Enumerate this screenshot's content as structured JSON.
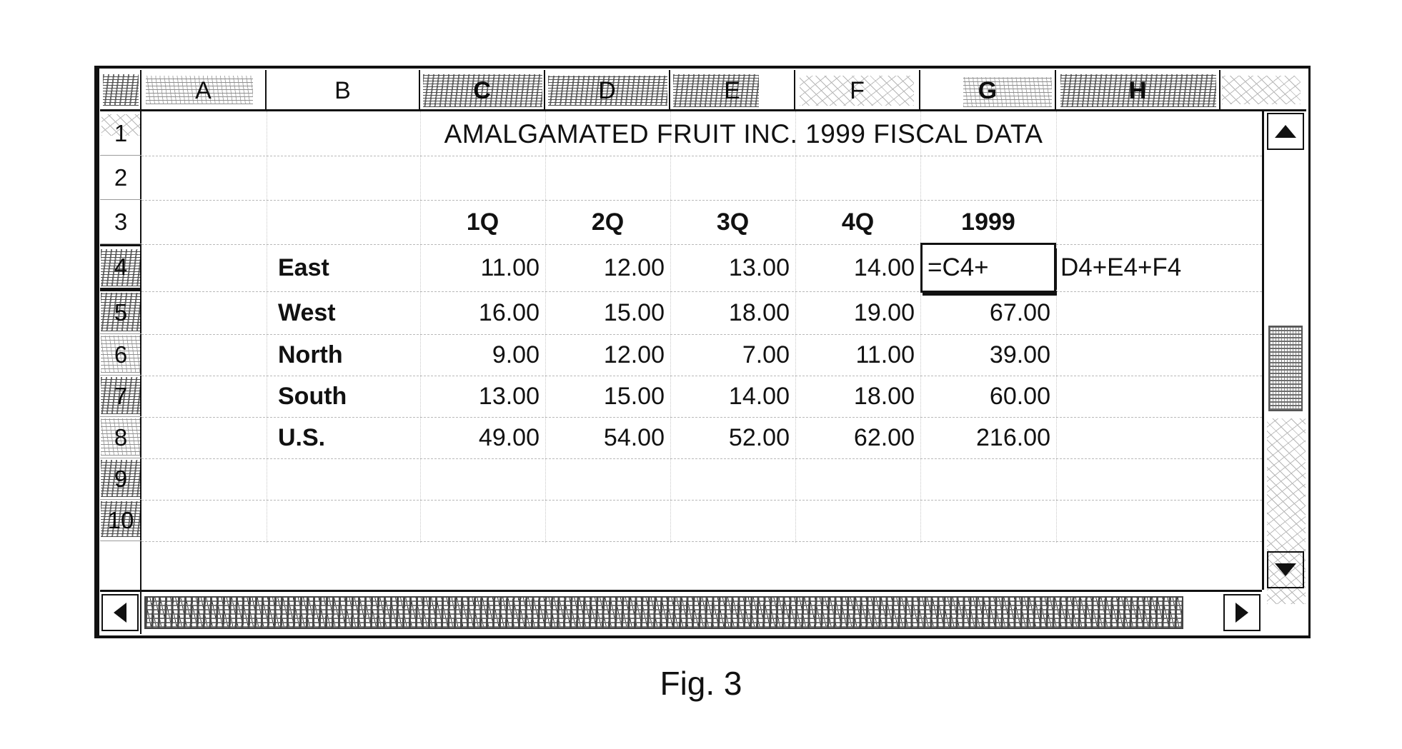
{
  "figure": {
    "caption": "Fig. 3"
  },
  "spreadsheet": {
    "column_headers": [
      "A",
      "B",
      "C",
      "D",
      "E",
      "F",
      "G",
      "H"
    ],
    "row_headers": [
      "1",
      "2",
      "3",
      "4",
      "5",
      "6",
      "7",
      "8",
      "9",
      "10"
    ],
    "selected_row_header": "4",
    "active_cell": {
      "reference": "G4",
      "editing": true,
      "content": "=C4+D4+E4+F4",
      "segment_in_cell": "=C4+",
      "segment_overflow": "D4+E4+F4"
    },
    "title_cell": {
      "row": "1",
      "text": "AMALGAMATED FRUIT INC. 1999 FISCAL DATA"
    },
    "header_row": {
      "row": "3",
      "labels": [
        "1Q",
        "2Q",
        "3Q",
        "4Q",
        "1999"
      ]
    },
    "data_rows": [
      {
        "row": "4",
        "label": "East",
        "q1": "11.00",
        "q2": "12.00",
        "q3": "13.00",
        "q4": "14.00",
        "total": "=C4+D4+E4+F4"
      },
      {
        "row": "5",
        "label": "West",
        "q1": "16.00",
        "q2": "15.00",
        "q3": "18.00",
        "q4": "19.00",
        "total": "67.00"
      },
      {
        "row": "6",
        "label": "North",
        "q1": "9.00",
        "q2": "12.00",
        "q3": "7.00",
        "q4": "11.00",
        "total": "39.00"
      },
      {
        "row": "7",
        "label": "South",
        "q1": "13.00",
        "q2": "15.00",
        "q3": "14.00",
        "q4": "18.00",
        "total": "60.00"
      },
      {
        "row": "8",
        "label": "U.S.",
        "q1": "49.00",
        "q2": "54.00",
        "q3": "52.00",
        "q4": "62.00",
        "total": "216.00"
      }
    ],
    "scrollbars": {
      "vertical": {
        "up_icon": "triangle-up-icon",
        "down_icon": "triangle-down-icon"
      },
      "horizontal": {
        "left_icon": "triangle-left-icon",
        "right_icon": "triangle-right-icon"
      }
    },
    "colors": {
      "ink": "#111111",
      "paper": "#ffffff",
      "gridline": "#b9b9b9"
    }
  }
}
